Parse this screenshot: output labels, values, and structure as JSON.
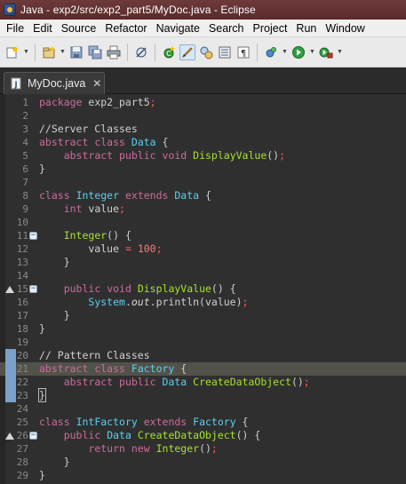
{
  "window": {
    "title": "Java - exp2/src/exp2_part5/MyDoc.java - Eclipse"
  },
  "menu": [
    "File",
    "Edit",
    "Source",
    "Refactor",
    "Navigate",
    "Search",
    "Project",
    "Run",
    "Window"
  ],
  "toolbar": {
    "icons": [
      "new-wizard-icon",
      "new-java-project-icon",
      "save-icon",
      "save-all-icon",
      "print-icon",
      "skip-breakpoints-icon",
      "new-java-class-icon",
      "pen-annotation-icon",
      "open-type-icon",
      "open-task-icon",
      "show-whitespace-icon",
      "toggle-breakpoint-icon",
      "run-icon",
      "external-tools-icon"
    ]
  },
  "editor": {
    "tab_label": "MyDoc.java",
    "tab_close": "✕",
    "highlighted_line": 21,
    "bookmarked_lines": [
      20,
      21,
      22,
      23
    ],
    "lines": [
      {
        "n": "1",
        "segs": [
          [
            "kw",
            "package"
          ],
          [
            "",
            ""
          ],
          [
            "cm",
            " exp2_part5"
          ],
          [
            "rd",
            ";"
          ]
        ]
      },
      {
        "n": "2",
        "segs": []
      },
      {
        "n": "3",
        "segs": [
          [
            "cm",
            "//Server Classes"
          ]
        ]
      },
      {
        "n": "4",
        "segs": [
          [
            "kw",
            "abstract"
          ],
          [
            "cm",
            " "
          ],
          [
            "kw",
            "class"
          ],
          [
            "cm",
            " "
          ],
          [
            "ty",
            "Data"
          ],
          [
            "cm",
            " {"
          ]
        ]
      },
      {
        "n": "5",
        "segs": [
          [
            "cm",
            "    "
          ],
          [
            "kw",
            "abstract"
          ],
          [
            "cm",
            " "
          ],
          [
            "kw",
            "public"
          ],
          [
            "cm",
            " "
          ],
          [
            "kw",
            "void"
          ],
          [
            "cm",
            " "
          ],
          [
            "fn",
            "DisplayValue"
          ],
          [
            "cm",
            "()"
          ],
          [
            "rd",
            ";"
          ]
        ]
      },
      {
        "n": "6",
        "segs": [
          [
            "cm",
            "}"
          ]
        ]
      },
      {
        "n": "7",
        "segs": []
      },
      {
        "n": "8",
        "segs": [
          [
            "kw",
            "class"
          ],
          [
            "cm",
            " "
          ],
          [
            "ty",
            "Integer"
          ],
          [
            "cm",
            " "
          ],
          [
            "kw",
            "extends"
          ],
          [
            "cm",
            " "
          ],
          [
            "ty",
            "Data"
          ],
          [
            "cm",
            " {"
          ]
        ]
      },
      {
        "n": "9",
        "segs": [
          [
            "cm",
            "    "
          ],
          [
            "kw",
            "int"
          ],
          [
            "cm",
            " value"
          ],
          [
            "rd",
            ";"
          ]
        ]
      },
      {
        "n": "10",
        "segs": []
      },
      {
        "n": "11",
        "segs": [
          [
            "cm",
            "    "
          ],
          [
            "fn",
            "Integer"
          ],
          [
            "cm",
            "() {"
          ]
        ]
      },
      {
        "n": "12",
        "segs": [
          [
            "cm",
            "        value "
          ],
          [
            "rd",
            "="
          ],
          [
            "cm",
            " "
          ],
          [
            "num",
            "100"
          ],
          [
            "rd",
            ";"
          ]
        ]
      },
      {
        "n": "13",
        "segs": [
          [
            "cm",
            "    }"
          ]
        ]
      },
      {
        "n": "14",
        "segs": []
      },
      {
        "n": "15",
        "segs": [
          [
            "cm",
            "    "
          ],
          [
            "kw",
            "public"
          ],
          [
            "cm",
            " "
          ],
          [
            "kw",
            "void"
          ],
          [
            "cm",
            " "
          ],
          [
            "fn",
            "DisplayValue"
          ],
          [
            "cm",
            "() {"
          ]
        ]
      },
      {
        "n": "16",
        "segs": [
          [
            "cm",
            "        "
          ],
          [
            "ty",
            "System"
          ],
          [
            "cm",
            "."
          ],
          [
            "it",
            "out"
          ],
          [
            "cm",
            ".println(value)"
          ],
          [
            "rd",
            ";"
          ]
        ]
      },
      {
        "n": "17",
        "segs": [
          [
            "cm",
            "    }"
          ]
        ]
      },
      {
        "n": "18",
        "segs": [
          [
            "cm",
            "}"
          ]
        ]
      },
      {
        "n": "19",
        "segs": []
      },
      {
        "n": "20",
        "segs": [
          [
            "cm",
            "// Pattern Classes"
          ]
        ]
      },
      {
        "n": "21",
        "segs": [
          [
            "kw",
            "abstract"
          ],
          [
            "cm",
            " "
          ],
          [
            "kw",
            "class"
          ],
          [
            "cm",
            " "
          ],
          [
            "ty",
            "Factory"
          ],
          [
            "cm",
            " {"
          ]
        ]
      },
      {
        "n": "22",
        "segs": [
          [
            "cm",
            "    "
          ],
          [
            "kw",
            "abstract"
          ],
          [
            "cm",
            " "
          ],
          [
            "kw",
            "public"
          ],
          [
            "cm",
            " "
          ],
          [
            "ty",
            "Data"
          ],
          [
            "cm",
            " "
          ],
          [
            "fn",
            "CreateDataObject"
          ],
          [
            "cm",
            "()"
          ],
          [
            "rd",
            ";"
          ]
        ]
      },
      {
        "n": "23",
        "segs": [
          [
            "box",
            "}"
          ]
        ]
      },
      {
        "n": "24",
        "segs": []
      },
      {
        "n": "25",
        "segs": [
          [
            "kw",
            "class"
          ],
          [
            "cm",
            " "
          ],
          [
            "ty",
            "IntFactory"
          ],
          [
            "cm",
            " "
          ],
          [
            "kw",
            "extends"
          ],
          [
            "cm",
            " "
          ],
          [
            "ty",
            "Factory"
          ],
          [
            "cm",
            " {"
          ]
        ]
      },
      {
        "n": "26",
        "segs": [
          [
            "cm",
            "    "
          ],
          [
            "kw",
            "public"
          ],
          [
            "cm",
            " "
          ],
          [
            "ty",
            "Data"
          ],
          [
            "cm",
            " "
          ],
          [
            "fn",
            "CreateDataObject"
          ],
          [
            "cm",
            "() {"
          ]
        ]
      },
      {
        "n": "27",
        "segs": [
          [
            "cm",
            "        "
          ],
          [
            "kw",
            "return"
          ],
          [
            "cm",
            " "
          ],
          [
            "kw",
            "new"
          ],
          [
            "cm",
            " "
          ],
          [
            "fn",
            "Integer"
          ],
          [
            "cm",
            "()"
          ],
          [
            "rd",
            ";"
          ]
        ]
      },
      {
        "n": "28",
        "segs": [
          [
            "cm",
            "    }"
          ]
        ]
      },
      {
        "n": "29",
        "segs": [
          [
            "cm",
            "}"
          ]
        ]
      }
    ],
    "fold_lines": [
      "11",
      "15",
      "26"
    ],
    "override_lines": [
      "15",
      "26"
    ]
  },
  "colors": {
    "keyword": "#cc6c9c",
    "type": "#5bd0f0",
    "method": "#a6e22e",
    "number": "#f08080",
    "editor_bg": "#2f2f2f",
    "current_line": "#52524a"
  }
}
